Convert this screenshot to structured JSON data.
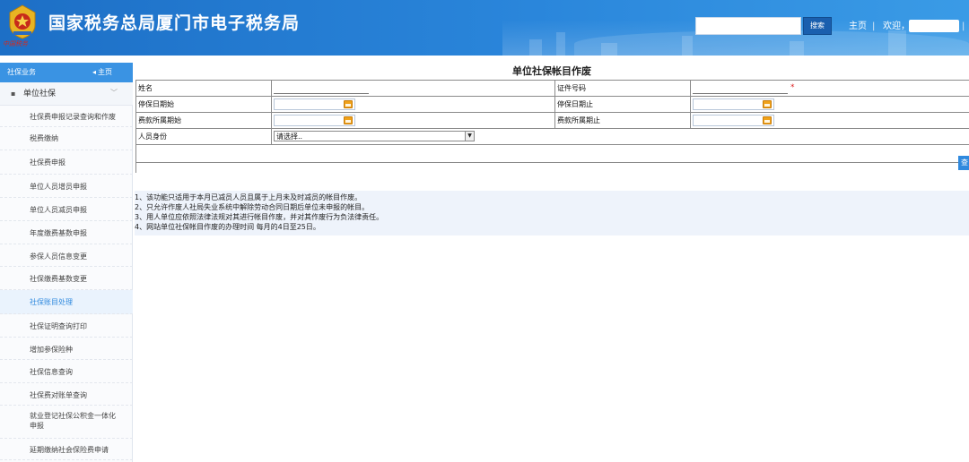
{
  "header": {
    "site_title": "国家税务总局厦门市电子税务局",
    "emblem_text": "中国税务",
    "search": {
      "value": "",
      "button_label": "搜索"
    },
    "nav": {
      "home_label": "主页",
      "separator": "|",
      "welcome_label": "欢迎，",
      "separator_end": "|"
    }
  },
  "sidebar": {
    "header_label": "社保业务",
    "home_label": "主页",
    "group_label": "单位社保",
    "items": [
      {
        "label": "社保费申报记录查询和作废"
      },
      {
        "label": "税费缴纳"
      },
      {
        "label": "社保费申报"
      },
      {
        "label": "单位人员增员申报"
      },
      {
        "label": "单位人员减员申报"
      },
      {
        "label": "年度缴费基数申报"
      },
      {
        "label": "参保人员信息变更"
      },
      {
        "label": "社保缴费基数变更"
      },
      {
        "label": "社保账目处理",
        "active": true
      },
      {
        "label": "社保证明查询打印"
      },
      {
        "label": "增加参保险种"
      },
      {
        "label": "社保信息查询"
      },
      {
        "label": "社保费对账单查询"
      },
      {
        "label_line1": "就业登记社保公积金一体化",
        "label_line2": "申报"
      },
      {
        "label": "延期缴纳社会保险费申请"
      }
    ]
  },
  "form": {
    "title": "单位社保帐目作废",
    "fields": {
      "name_label": "姓名",
      "id_number_label": "证件号码",
      "required_mark": "*",
      "stop_start_label": "停保日期始",
      "stop_end_label": "停保日期止",
      "period_start_label": "费款所属期始",
      "period_end_label": "费款所属期止",
      "identity_label": "人员身份",
      "identity_value": "请选择..",
      "select_arrow": "▼"
    },
    "query_label": "查"
  },
  "notes": [
    "1、该功能只适用于本月已减员人员且属于上月未及时减员的帐目作废。",
    "2、只允许作废人社局失业系统中解除劳动合同日期后单位未申报的帐目。",
    "3、用人单位应依照法律法规对其进行帐目作废，并对其作废行为负法律责任。",
    "4、网站单位社保帐目作废的办理时间 每月的4日至25日。"
  ],
  "colors": {
    "header_blue": "#2a86db",
    "accent_blue": "#2f89de",
    "search_button": "#1a5fae",
    "required_red": "#dd2222",
    "date_icon_orange": "#f0a21a"
  }
}
